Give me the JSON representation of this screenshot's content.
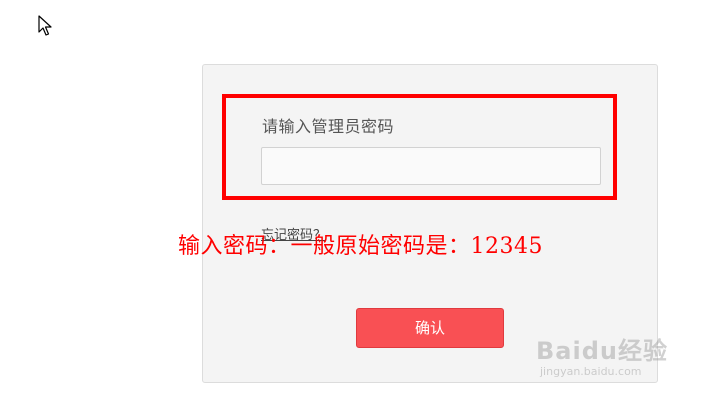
{
  "login": {
    "prompt_label": "请输入管理员密码",
    "password_value": "",
    "password_placeholder": "",
    "forgot_link": "忘记密码？",
    "confirm_button": "确认"
  },
  "annotation": {
    "text": "输入密码：一般原始密码是：12345",
    "color": "#ff0000"
  },
  "highlight": {
    "color": "#ff0000"
  },
  "watermark": {
    "brand": "Baidu经验",
    "url": "jingyan.baidu.com"
  },
  "colors": {
    "panel_background": "#f4f4f4",
    "button_background": "#f95054",
    "button_text": "#ffffff"
  },
  "icons": {
    "cursor": "mouse-pointer-icon"
  }
}
